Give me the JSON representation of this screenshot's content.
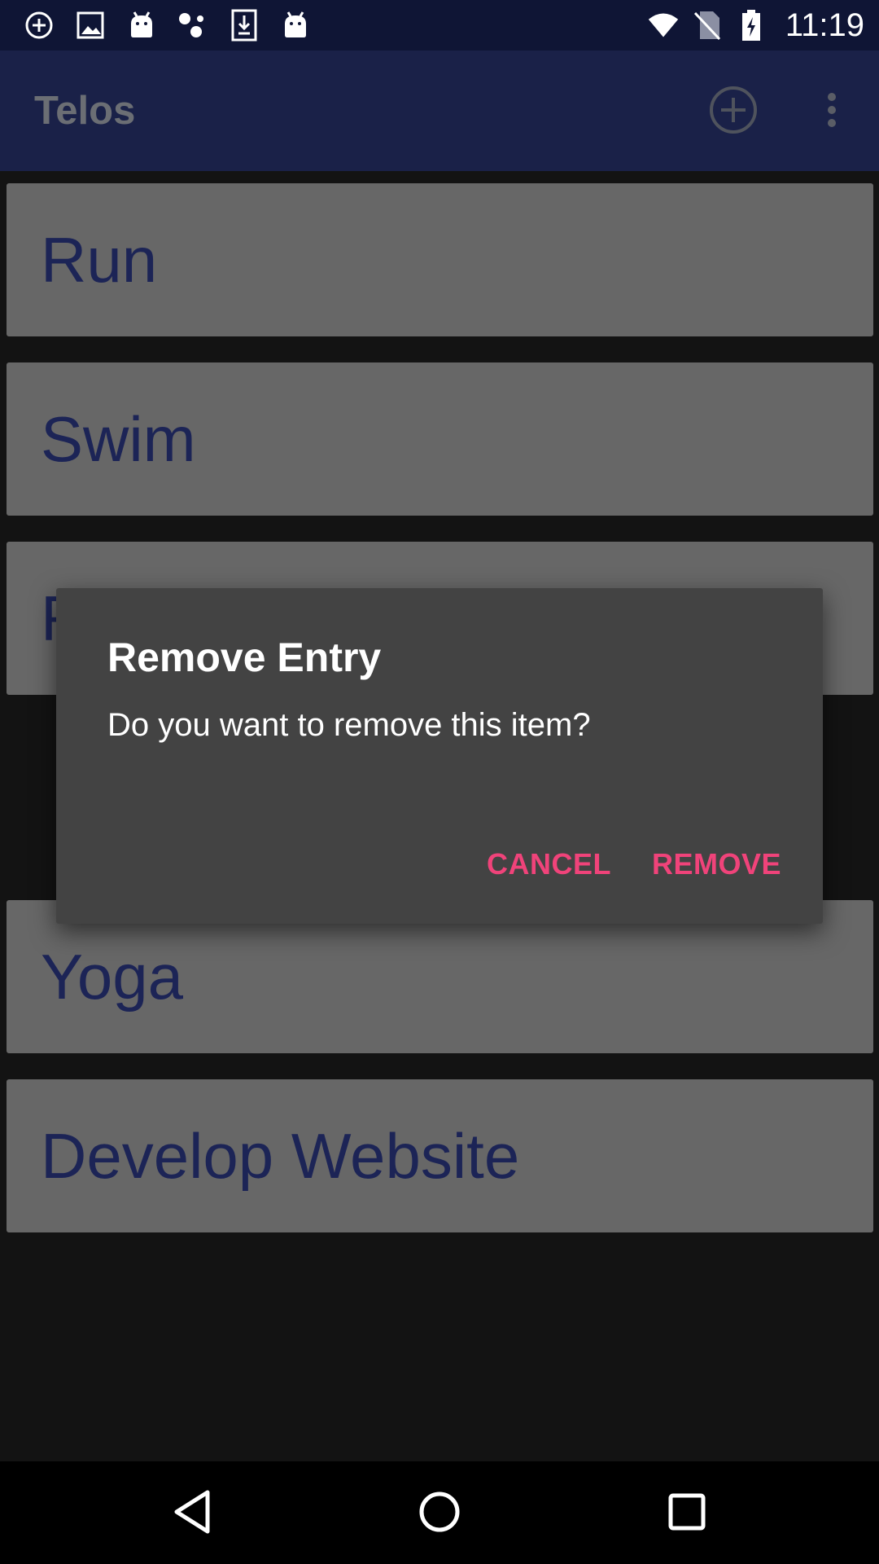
{
  "status_bar": {
    "time": "11:19",
    "icons_left": [
      "add-circle-icon",
      "image-icon",
      "android-icon",
      "assistant-icon",
      "download-icon",
      "android-icon"
    ],
    "icons_right": [
      "wifi-icon",
      "no-sim-icon",
      "battery-charging-icon"
    ]
  },
  "app_bar": {
    "title": "Telos",
    "actions": [
      "add-circle-icon",
      "more-vert-icon"
    ]
  },
  "list": {
    "items": [
      {
        "label": "Run"
      },
      {
        "label": "Swim"
      },
      {
        "label": "R"
      },
      {
        "label": "Yoga"
      },
      {
        "label": "Develop Website"
      }
    ]
  },
  "dialog": {
    "title": "Remove Entry",
    "message": "Do you want to remove this item?",
    "cancel_label": "CANCEL",
    "remove_label": "REMOVE"
  },
  "nav_bar": {
    "buttons": [
      "back-icon",
      "home-icon",
      "recents-icon"
    ]
  },
  "colors": {
    "status_bar_bg": "#0f1535",
    "app_bar_bg": "#1a2148",
    "card_bg": "#676767",
    "card_text": "#1c2456",
    "dialog_bg": "#434343",
    "accent": "#f0437a"
  }
}
